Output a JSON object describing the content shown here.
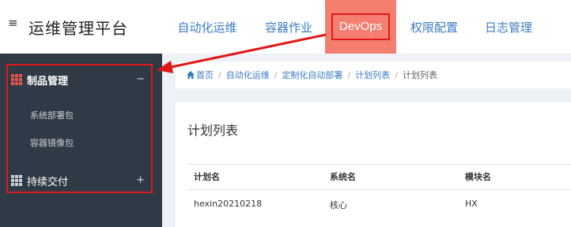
{
  "header": {
    "menu_icon": "≡",
    "app_title": "运维管理平台",
    "nav": [
      {
        "label": "自动化运维"
      },
      {
        "label": "容器作业"
      },
      {
        "label": "DevOps",
        "active": true
      },
      {
        "label": "权限配置"
      },
      {
        "label": "日志管理"
      }
    ]
  },
  "sidebar": {
    "groups": [
      {
        "label": "制品管理",
        "toggle": "−",
        "expanded": true,
        "items": [
          {
            "label": "系统部署包"
          },
          {
            "label": "容器镜像包"
          }
        ]
      },
      {
        "label": "持续交付",
        "toggle": "+",
        "expanded": false
      }
    ]
  },
  "breadcrumb": [
    {
      "label": "首页"
    },
    {
      "label": "自动化运维"
    },
    {
      "label": "定制化自动部署"
    },
    {
      "label": "计划列表"
    },
    {
      "label": "计划列表"
    }
  ],
  "panel": {
    "title": "计划列表",
    "columns": [
      "计划名",
      "系统名",
      "模块名"
    ],
    "rows": [
      [
        "hexin20210218",
        "核心",
        "HX"
      ]
    ]
  },
  "colors": {
    "nav_link": "#3a7cc2",
    "nav_active_bg": "#f47f70",
    "highlight": "#e01818",
    "sidebar_bg": "#2f3a46",
    "icon_accent": "#e8564a"
  },
  "icons": {
    "menu": "hamburger-icon",
    "group": "grid-icon",
    "home": "home-icon",
    "annotation": "red-arrow"
  }
}
